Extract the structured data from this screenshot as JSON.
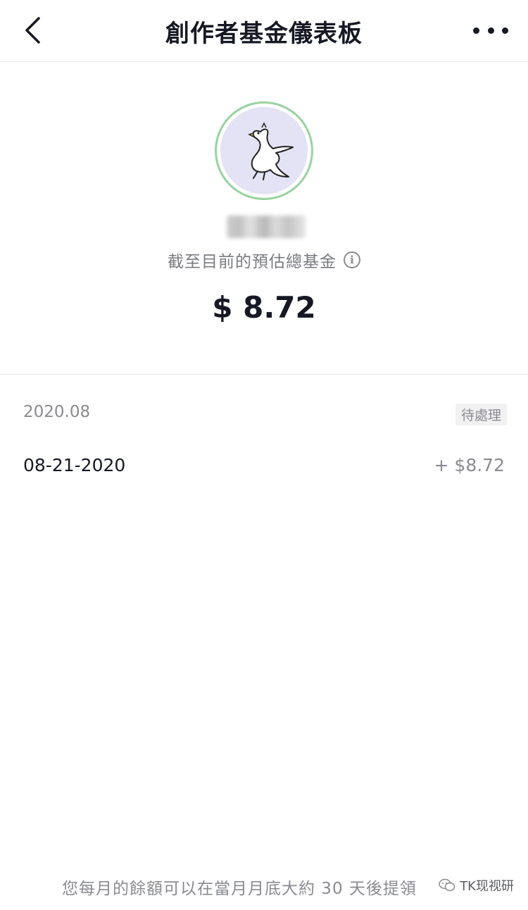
{
  "header": {
    "title": "創作者基金儀表板",
    "back_icon": "chevron-left-icon",
    "more_icon": "more-horizontal-icon"
  },
  "profile": {
    "estimate_label": "截至目前的預估總基金",
    "info_icon_glyph": "i",
    "total_amount": "$ 8.72"
  },
  "earnings": {
    "month": "2020.08",
    "status": "待處理",
    "rows": [
      {
        "date": "08-21-2020",
        "amount": "+ $8.72"
      }
    ]
  },
  "footer": {
    "note": "您每月的餘額可以在當月月底大約 30 天後提領",
    "watermark": "TK现视研"
  },
  "colors": {
    "avatar_bg": "#e4e3f5",
    "avatar_ring": "#9ad2a0",
    "text_primary": "#161823",
    "text_secondary": "#8a8b91"
  }
}
